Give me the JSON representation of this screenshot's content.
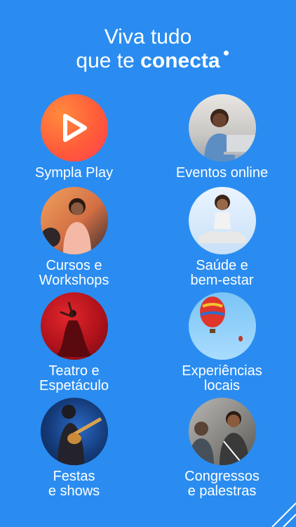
{
  "headline": {
    "line1": "Viva tudo",
    "line2_prefix": "que te ",
    "line2_brand": "conecta"
  },
  "categories": [
    {
      "label": "Sympla Play",
      "icon": "play-icon"
    },
    {
      "label": "Eventos online",
      "icon": "laptop-person-photo"
    },
    {
      "label": "Cursos e\nWorkshops",
      "icon": "presenter-photo"
    },
    {
      "label": "Saúde e\nbem-estar",
      "icon": "meditation-photo"
    },
    {
      "label": "Teatro e\nEspetáculo",
      "icon": "dancer-photo"
    },
    {
      "label": "Experiências\nlocais",
      "icon": "hot-air-balloon-photo"
    },
    {
      "label": "Festas\ne shows",
      "icon": "concert-guitar-photo"
    },
    {
      "label": "Congressos\ne palestras",
      "icon": "conference-people-photo"
    }
  ],
  "colors": {
    "background": "#2a8cf0",
    "text": "#ffffff",
    "play_gradient_start": "#ff8a3d",
    "play_gradient_end": "#ff3f4f"
  }
}
